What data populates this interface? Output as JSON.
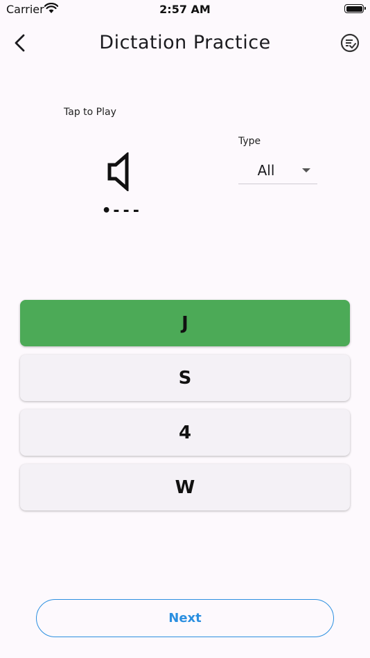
{
  "status_bar": {
    "carrier": "Carrier",
    "time": "2:57 AM"
  },
  "app_bar": {
    "title": "Dictation Practice",
    "back_icon": "chevron-left-icon",
    "action_icon": "checklist-icon"
  },
  "player": {
    "tap_label": "Tap to Play",
    "morse_code": "•---",
    "speaker_icon": "speaker-icon"
  },
  "type_selector": {
    "label": "Type",
    "selected": "All"
  },
  "options": [
    {
      "label": "J",
      "state": "correct"
    },
    {
      "label": "S",
      "state": "default"
    },
    {
      "label": "4",
      "state": "default"
    },
    {
      "label": "W",
      "state": "default"
    }
  ],
  "colors": {
    "correct": "#4caa57",
    "accent": "#2b8fe0",
    "background": "#fdf9fd"
  },
  "next_button": {
    "label": "Next"
  }
}
